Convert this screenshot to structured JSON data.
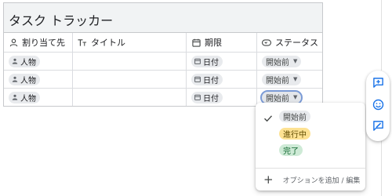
{
  "table": {
    "title": "タスク トラッカー",
    "columns": [
      {
        "label": "割り当て先",
        "icon": "person-icon"
      },
      {
        "label": "タイトル",
        "icon": "text-type-icon"
      },
      {
        "label": "期限",
        "icon": "calendar-icon"
      },
      {
        "label": "ステータス",
        "icon": "dropdown-chip-icon"
      }
    ],
    "rows": [
      {
        "assignee": "人物",
        "title": "",
        "due": "日付",
        "status": "開始前"
      },
      {
        "assignee": "人物",
        "title": "",
        "due": "日付",
        "status": "開始前"
      },
      {
        "assignee": "人物",
        "title": "",
        "due": "日付",
        "status": "開始前"
      }
    ]
  },
  "status_dropdown": {
    "selected": "開始前",
    "options": [
      {
        "label": "開始前",
        "bg": "#e8eaed",
        "fg": "#444746",
        "selected": true
      },
      {
        "label": "進行中",
        "bg": "#fde293",
        "fg": "#5f4b00",
        "selected": false
      },
      {
        "label": "完了",
        "bg": "#ceead6",
        "fg": "#0d652d",
        "selected": false
      }
    ],
    "add_option_label": "オプションを追加 / 編集"
  },
  "side_toolbar": {
    "buttons": [
      {
        "icon": "add-comment-icon"
      },
      {
        "icon": "emoji-icon"
      },
      {
        "icon": "suggest-edit-icon"
      }
    ]
  },
  "colors": {
    "accent": "#1a73e8",
    "header_bg": "#f1f3f4",
    "chip_bg": "#e8eaed"
  }
}
